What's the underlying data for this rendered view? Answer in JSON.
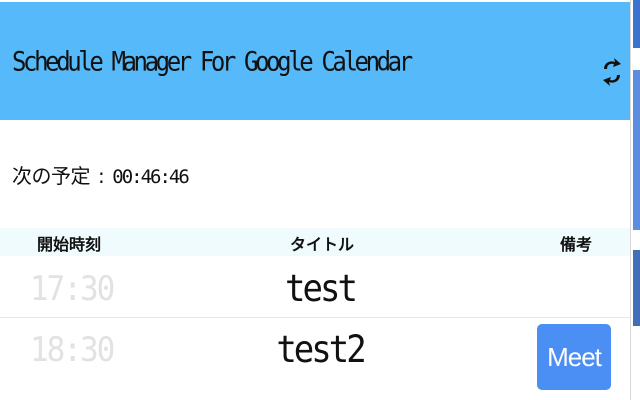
{
  "header": {
    "title": "Schedule Manager For Google Calendar",
    "refresh_icon": "refresh-icon"
  },
  "next_event": {
    "label": "次の予定",
    "separator": ":",
    "countdown": "00:46:46"
  },
  "table": {
    "columns": {
      "start": "開始時刻",
      "title": "タイトル",
      "notes": "備考"
    },
    "rows": [
      {
        "time": "17:30",
        "title": "test",
        "action": ""
      },
      {
        "time": "18:30",
        "title": "test2",
        "action": "Meet"
      }
    ]
  },
  "colors": {
    "header_bg": "#56b9f9",
    "table_head_bg": "#f0fbfd",
    "meet_button": "#4c8ff4",
    "past_time_text": "#e2e2e2"
  }
}
